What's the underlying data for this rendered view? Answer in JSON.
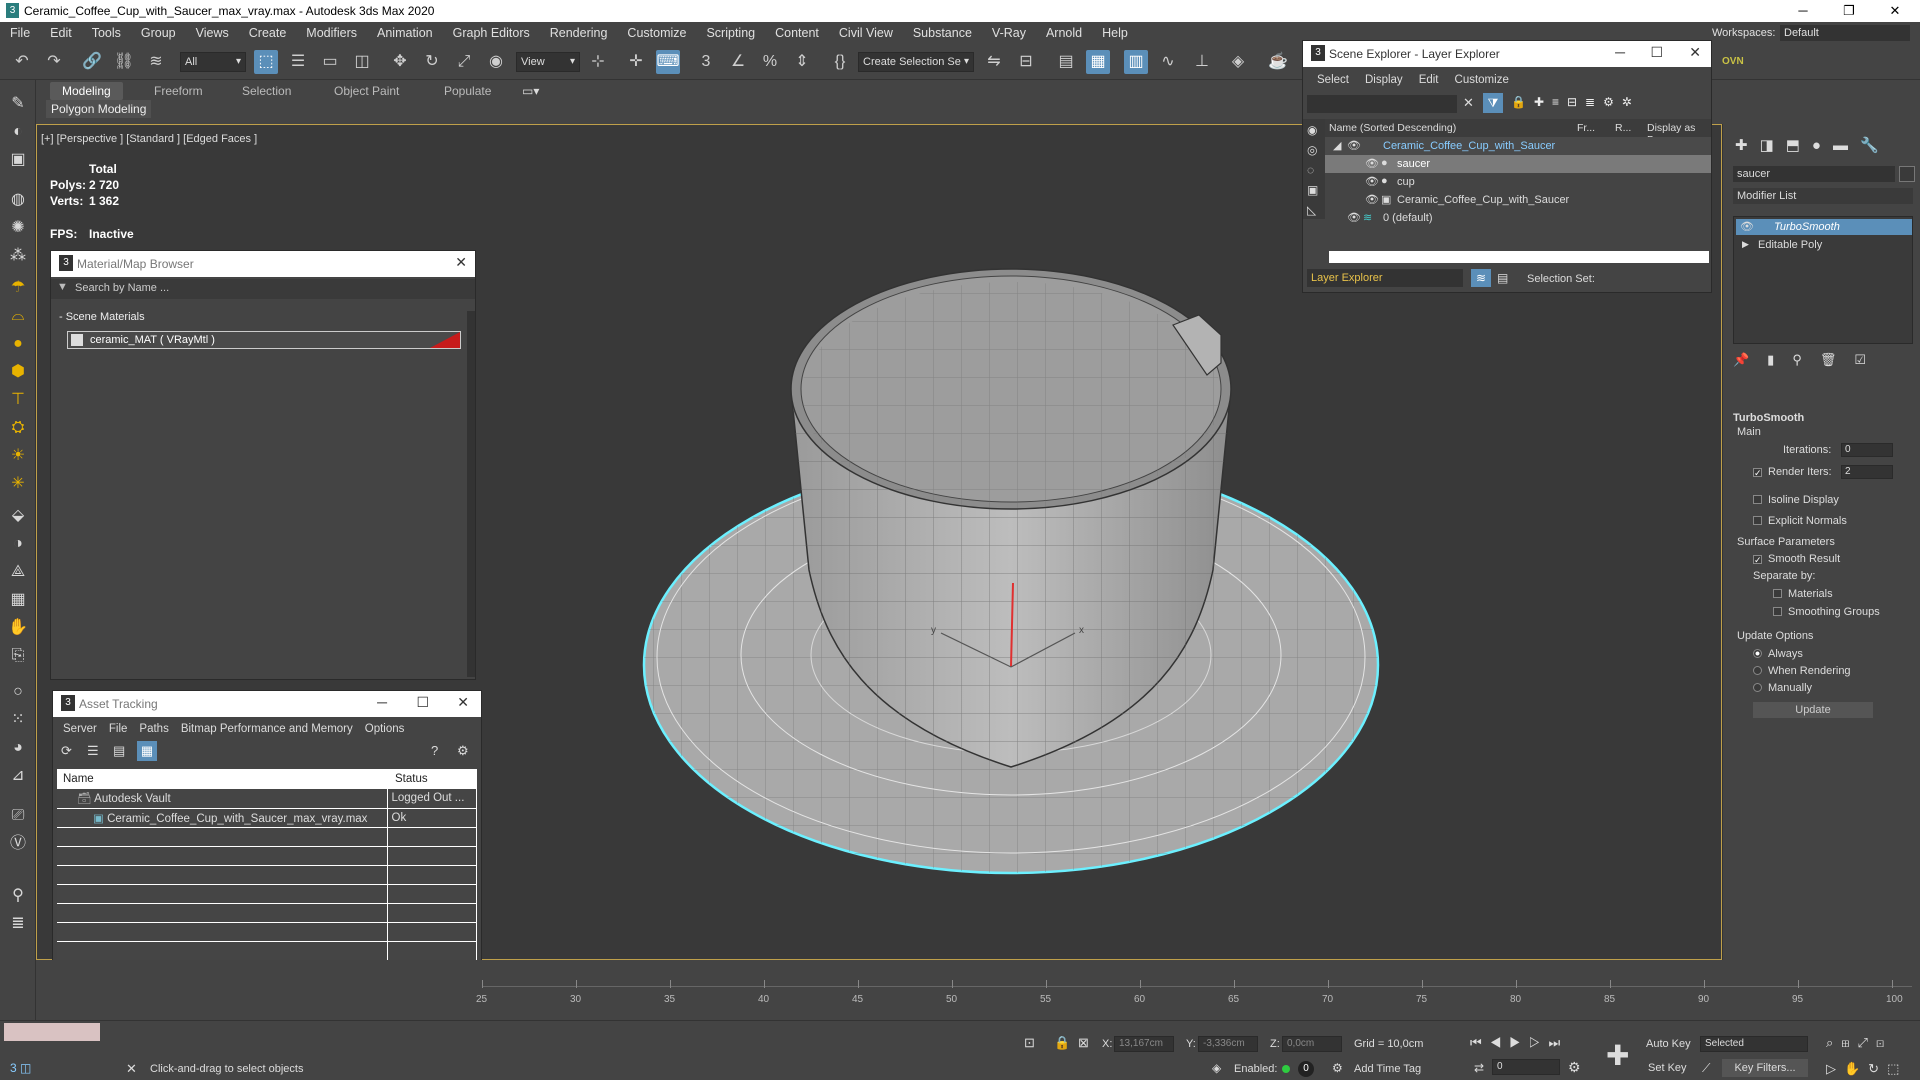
{
  "window": {
    "title": "Ceramic_Coffee_Cup_with_Saucer_max_vray.max - Autodesk 3ds Max 2020",
    "minimize": "─",
    "maximize": "❐",
    "close": "✕"
  },
  "menu": [
    "File",
    "Edit",
    "Tools",
    "Group",
    "Views",
    "Create",
    "Modifiers",
    "Animation",
    "Graph Editors",
    "Rendering",
    "Customize",
    "Scripting",
    "Content",
    "Civil View",
    "Substance",
    "V-Ray",
    "Arnold",
    "Help"
  ],
  "workspaces": {
    "label": "Workspaces:",
    "value": "Default"
  },
  "toolbar": {
    "filter": "All",
    "view": "View",
    "selection_set": "Create Selection Se",
    "ovn": "OVN"
  },
  "ribbon": {
    "tabs": [
      "Modeling",
      "Freeform",
      "Selection",
      "Object Paint",
      "Populate"
    ],
    "subtab": "Polygon Modeling"
  },
  "viewport": {
    "label": "[+] [Perspective ] [Standard ] [Edged Faces ]",
    "total": "Total",
    "polys_label": "Polys:",
    "polys": "2 720",
    "verts_label": "Verts:",
    "verts": "1 362",
    "fps_label": "FPS:",
    "fps": "Inactive",
    "axis_x": "x",
    "axis_y": "y"
  },
  "material_browser": {
    "title": "Material/Map Browser",
    "search_placeholder": "Search by Name ...",
    "group": "- Scene Materials",
    "item": "ceramic_MAT  ( VRayMtl )"
  },
  "asset_tracking": {
    "title": "Asset Tracking",
    "menu": [
      "Server",
      "File",
      "Paths",
      "Bitmap Performance and Memory",
      "Options"
    ],
    "col_name": "Name",
    "col_status": "Status",
    "rows": [
      {
        "name": "Autodesk Vault",
        "status": "Logged Out ..."
      },
      {
        "name": "Ceramic_Coffee_Cup_with_Saucer_max_vray.max",
        "status": "Ok"
      }
    ]
  },
  "scene_explorer": {
    "title": "Scene Explorer - Layer Explorer",
    "menu": [
      "Select",
      "Display",
      "Edit",
      "Customize"
    ],
    "col_name": "Name (Sorted Descending)",
    "col_fr": "Fr...",
    "col_r": "R...",
    "col_disp": "Display as Bo:",
    "rows": [
      "Ceramic_Coffee_Cup_with_Saucer",
      "saucer",
      "cup",
      "Ceramic_Coffee_Cup_with_Saucer",
      "0 (default)"
    ],
    "footer_dropdown": "Layer Explorer",
    "selection_set": "Selection Set:"
  },
  "command_panel": {
    "object_name": "saucer",
    "modifier_list": "Modifier List",
    "stack": [
      "TurboSmooth",
      "Editable Poly"
    ],
    "rollout": "TurboSmooth",
    "main": "Main",
    "iterations_label": "Iterations:",
    "iterations": "0",
    "render_iters_label": "Render Iters:",
    "render_iters": "2",
    "isoline": "Isoline Display",
    "explicit": "Explicit Normals",
    "surface": "Surface Parameters",
    "smooth": "Smooth Result",
    "separate": "Separate by:",
    "materials": "Materials",
    "smoothing": "Smoothing Groups",
    "update_opts": "Update Options",
    "always": "Always",
    "when_rendering": "When Rendering",
    "manually": "Manually",
    "update_btn": "Update"
  },
  "timeline": {
    "ticks": [
      "25",
      "30",
      "35",
      "40",
      "45",
      "50",
      "55",
      "60",
      "65",
      "70",
      "75",
      "80",
      "85",
      "90",
      "95",
      "100"
    ]
  },
  "status": {
    "prompt": "Click-and-drag to select objects",
    "x_label": "X:",
    "x": "13,167cm",
    "y_label": "Y:",
    "y": "-3,336cm",
    "z_label": "Z:",
    "z": "0,0cm",
    "grid": "Grid = 10,0cm",
    "enabled": "Enabled:",
    "add_time_tag": "Add Time Tag",
    "auto_key": "Auto Key",
    "set_key": "Set Key",
    "selected": "Selected",
    "key_filters": "Key Filters...",
    "frame": "0"
  }
}
